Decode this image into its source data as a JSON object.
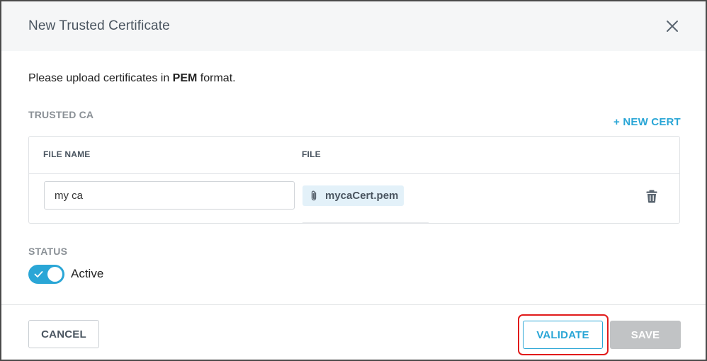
{
  "dialog": {
    "title": "New Trusted Certificate",
    "close_icon": "close-icon"
  },
  "intro": {
    "prefix": "Please upload certificates in ",
    "format": "PEM",
    "suffix": " format."
  },
  "trusted_ca": {
    "label": "TRUSTED CA",
    "new_cert_label": "+ NEW CERT",
    "columns": [
      "FILE NAME",
      "FILE"
    ],
    "rows": [
      {
        "file_name": "my ca",
        "file": "mycaCert.pem",
        "file_icon": "paperclip-icon",
        "delete_icon": "trash-icon"
      }
    ]
  },
  "status": {
    "label": "STATUS",
    "toggle_on": true,
    "toggle_label": "Active"
  },
  "footer": {
    "cancel_label": "CANCEL",
    "validate_label": "VALIDATE",
    "save_label": "SAVE"
  },
  "colors": {
    "accent": "#2aa6d6",
    "highlight": "#e11b1b",
    "disabled": "#c1c3c5"
  }
}
